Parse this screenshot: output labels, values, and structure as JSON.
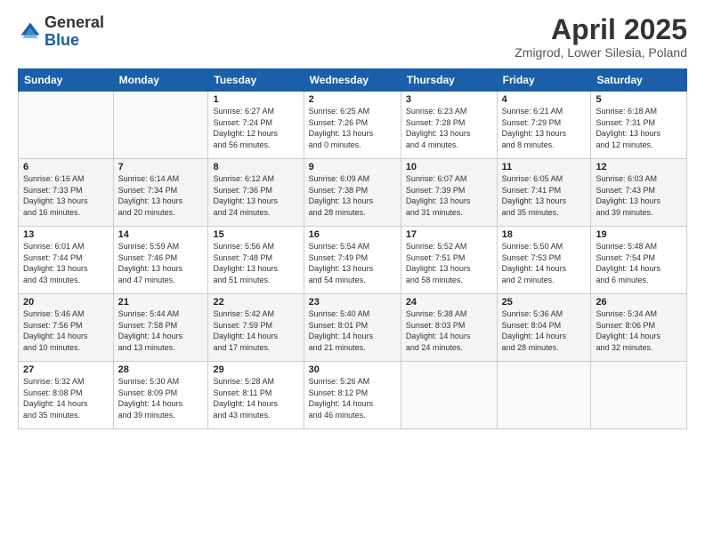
{
  "logo": {
    "general": "General",
    "blue": "Blue"
  },
  "header": {
    "month": "April 2025",
    "location": "Zmigrod, Lower Silesia, Poland"
  },
  "weekdays": [
    "Sunday",
    "Monday",
    "Tuesday",
    "Wednesday",
    "Thursday",
    "Friday",
    "Saturday"
  ],
  "weeks": [
    [
      {
        "day": "",
        "info": ""
      },
      {
        "day": "",
        "info": ""
      },
      {
        "day": "1",
        "info": "Sunrise: 6:27 AM\nSunset: 7:24 PM\nDaylight: 12 hours\nand 56 minutes."
      },
      {
        "day": "2",
        "info": "Sunrise: 6:25 AM\nSunset: 7:26 PM\nDaylight: 13 hours\nand 0 minutes."
      },
      {
        "day": "3",
        "info": "Sunrise: 6:23 AM\nSunset: 7:28 PM\nDaylight: 13 hours\nand 4 minutes."
      },
      {
        "day": "4",
        "info": "Sunrise: 6:21 AM\nSunset: 7:29 PM\nDaylight: 13 hours\nand 8 minutes."
      },
      {
        "day": "5",
        "info": "Sunrise: 6:18 AM\nSunset: 7:31 PM\nDaylight: 13 hours\nand 12 minutes."
      }
    ],
    [
      {
        "day": "6",
        "info": "Sunrise: 6:16 AM\nSunset: 7:33 PM\nDaylight: 13 hours\nand 16 minutes."
      },
      {
        "day": "7",
        "info": "Sunrise: 6:14 AM\nSunset: 7:34 PM\nDaylight: 13 hours\nand 20 minutes."
      },
      {
        "day": "8",
        "info": "Sunrise: 6:12 AM\nSunset: 7:36 PM\nDaylight: 13 hours\nand 24 minutes."
      },
      {
        "day": "9",
        "info": "Sunrise: 6:09 AM\nSunset: 7:38 PM\nDaylight: 13 hours\nand 28 minutes."
      },
      {
        "day": "10",
        "info": "Sunrise: 6:07 AM\nSunset: 7:39 PM\nDaylight: 13 hours\nand 31 minutes."
      },
      {
        "day": "11",
        "info": "Sunrise: 6:05 AM\nSunset: 7:41 PM\nDaylight: 13 hours\nand 35 minutes."
      },
      {
        "day": "12",
        "info": "Sunrise: 6:03 AM\nSunset: 7:43 PM\nDaylight: 13 hours\nand 39 minutes."
      }
    ],
    [
      {
        "day": "13",
        "info": "Sunrise: 6:01 AM\nSunset: 7:44 PM\nDaylight: 13 hours\nand 43 minutes."
      },
      {
        "day": "14",
        "info": "Sunrise: 5:59 AM\nSunset: 7:46 PM\nDaylight: 13 hours\nand 47 minutes."
      },
      {
        "day": "15",
        "info": "Sunrise: 5:56 AM\nSunset: 7:48 PM\nDaylight: 13 hours\nand 51 minutes."
      },
      {
        "day": "16",
        "info": "Sunrise: 5:54 AM\nSunset: 7:49 PM\nDaylight: 13 hours\nand 54 minutes."
      },
      {
        "day": "17",
        "info": "Sunrise: 5:52 AM\nSunset: 7:51 PM\nDaylight: 13 hours\nand 58 minutes."
      },
      {
        "day": "18",
        "info": "Sunrise: 5:50 AM\nSunset: 7:53 PM\nDaylight: 14 hours\nand 2 minutes."
      },
      {
        "day": "19",
        "info": "Sunrise: 5:48 AM\nSunset: 7:54 PM\nDaylight: 14 hours\nand 6 minutes."
      }
    ],
    [
      {
        "day": "20",
        "info": "Sunrise: 5:46 AM\nSunset: 7:56 PM\nDaylight: 14 hours\nand 10 minutes."
      },
      {
        "day": "21",
        "info": "Sunrise: 5:44 AM\nSunset: 7:58 PM\nDaylight: 14 hours\nand 13 minutes."
      },
      {
        "day": "22",
        "info": "Sunrise: 5:42 AM\nSunset: 7:59 PM\nDaylight: 14 hours\nand 17 minutes."
      },
      {
        "day": "23",
        "info": "Sunrise: 5:40 AM\nSunset: 8:01 PM\nDaylight: 14 hours\nand 21 minutes."
      },
      {
        "day": "24",
        "info": "Sunrise: 5:38 AM\nSunset: 8:03 PM\nDaylight: 14 hours\nand 24 minutes."
      },
      {
        "day": "25",
        "info": "Sunrise: 5:36 AM\nSunset: 8:04 PM\nDaylight: 14 hours\nand 28 minutes."
      },
      {
        "day": "26",
        "info": "Sunrise: 5:34 AM\nSunset: 8:06 PM\nDaylight: 14 hours\nand 32 minutes."
      }
    ],
    [
      {
        "day": "27",
        "info": "Sunrise: 5:32 AM\nSunset: 8:08 PM\nDaylight: 14 hours\nand 35 minutes."
      },
      {
        "day": "28",
        "info": "Sunrise: 5:30 AM\nSunset: 8:09 PM\nDaylight: 14 hours\nand 39 minutes."
      },
      {
        "day": "29",
        "info": "Sunrise: 5:28 AM\nSunset: 8:11 PM\nDaylight: 14 hours\nand 43 minutes."
      },
      {
        "day": "30",
        "info": "Sunrise: 5:26 AM\nSunset: 8:12 PM\nDaylight: 14 hours\nand 46 minutes."
      },
      {
        "day": "",
        "info": ""
      },
      {
        "day": "",
        "info": ""
      },
      {
        "day": "",
        "info": ""
      }
    ]
  ]
}
